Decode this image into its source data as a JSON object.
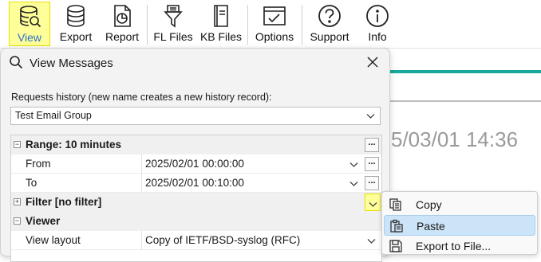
{
  "toolbar": {
    "items": [
      {
        "label": "View",
        "icon": "database-search-icon",
        "active": true
      },
      {
        "label": "Export",
        "icon": "database-export-icon"
      },
      {
        "label": "Report",
        "icon": "report-chart-icon"
      },
      {
        "label": "FL Files",
        "icon": "funnel-file-icon"
      },
      {
        "label": "KB Files",
        "icon": "kb-book-icon"
      },
      {
        "label": "Options",
        "icon": "options-window-icon"
      },
      {
        "label": "Support",
        "icon": "question-circle-icon"
      },
      {
        "label": "Info",
        "icon": "info-circle-icon"
      }
    ]
  },
  "background": {
    "date_fragment": "5/03/01 14:36",
    "accent_color": "#19a89a"
  },
  "panel": {
    "title": "View Messages",
    "history_label": "Requests history (new name creates a new history record):",
    "history_value": "Test Email Group",
    "grid": {
      "range_category": "Range: 10 minutes",
      "from_label": "From",
      "from_value": "2025/02/01 00:00:00",
      "to_label": "To",
      "to_value": "2025/02/01 00:10:00",
      "filter_category": "Filter [no filter]",
      "viewer_category": "Viewer",
      "view_layout_label": "View layout",
      "view_layout_value": "Copy of IETF/BSD-syslog (RFC)",
      "ellipsis": "..."
    }
  },
  "context_menu": {
    "items": [
      {
        "label": "Copy",
        "icon": "copy-icon"
      },
      {
        "label": "Paste",
        "icon": "paste-icon",
        "hovered": true
      },
      {
        "label": "Export to File...",
        "icon": "save-disk-icon"
      }
    ]
  },
  "colors": {
    "active_highlight": "#ffff99",
    "menu_hover": "#cce4f7"
  }
}
